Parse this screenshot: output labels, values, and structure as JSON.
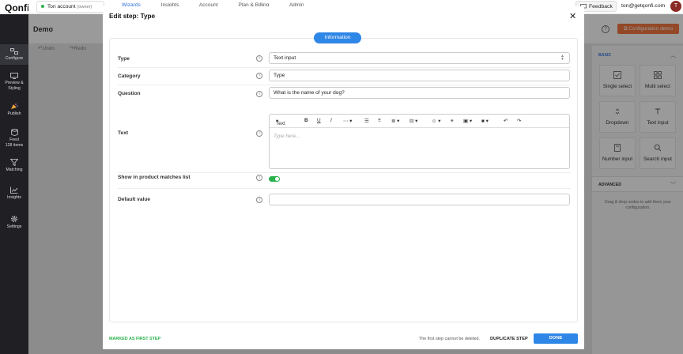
{
  "app": {
    "logo": "Qonfi"
  },
  "sidebar": {
    "items": [
      {
        "label": "Configure"
      },
      {
        "label": "Preview & Styling"
      },
      {
        "label": "Publish"
      },
      {
        "label": "Feed",
        "sub": "128 items"
      },
      {
        "label": "Matching"
      },
      {
        "label": "Insights"
      },
      {
        "label": "Settings"
      }
    ]
  },
  "topbar": {
    "account": "Ton account",
    "account_role": "(owner)",
    "tabs": [
      "Wizards",
      "Insights",
      "Account",
      "Plan & Billing",
      "Admin"
    ],
    "feedback": "Feedback",
    "email": "ton@getqonfi.com",
    "avatar": "T"
  },
  "page": {
    "title": "Demo",
    "help": "?",
    "config_button": "Configuration demo",
    "undo": "Undo",
    "redo": "Redo"
  },
  "node_panel": {
    "basic_label": "BASIC",
    "tiles": [
      "Single select",
      "Multi select",
      "Dropdown",
      "Text input",
      "Number input",
      "Search input"
    ],
    "advanced_label": "ADVANCED",
    "hint": "Drag & drop nodes to add them your configuration."
  },
  "modal": {
    "title": "Edit step: Type",
    "tab": "Information",
    "rows": {
      "type_label": "Type",
      "type_value": "Text input",
      "category_label": "Category",
      "category_value": "Type",
      "question_label": "Question",
      "question_value": "What is the name of your dog?",
      "text_label": "Text",
      "text_placeholder": "Type here...",
      "show_label": "Show in product matches list",
      "show_on": true,
      "default_label": "Default value",
      "default_value": ""
    },
    "toolbar": {
      "text_style": "Text"
    },
    "footer": {
      "marked": "MARKED AS FIRST STEP",
      "note": "The first step cannot be deleted.",
      "duplicate": "DUPLICATE STEP",
      "done": "DONE"
    }
  },
  "colors": {
    "accent": "#2e86e6",
    "brand_orange": "#f26a2e",
    "success": "#2bb24c"
  }
}
